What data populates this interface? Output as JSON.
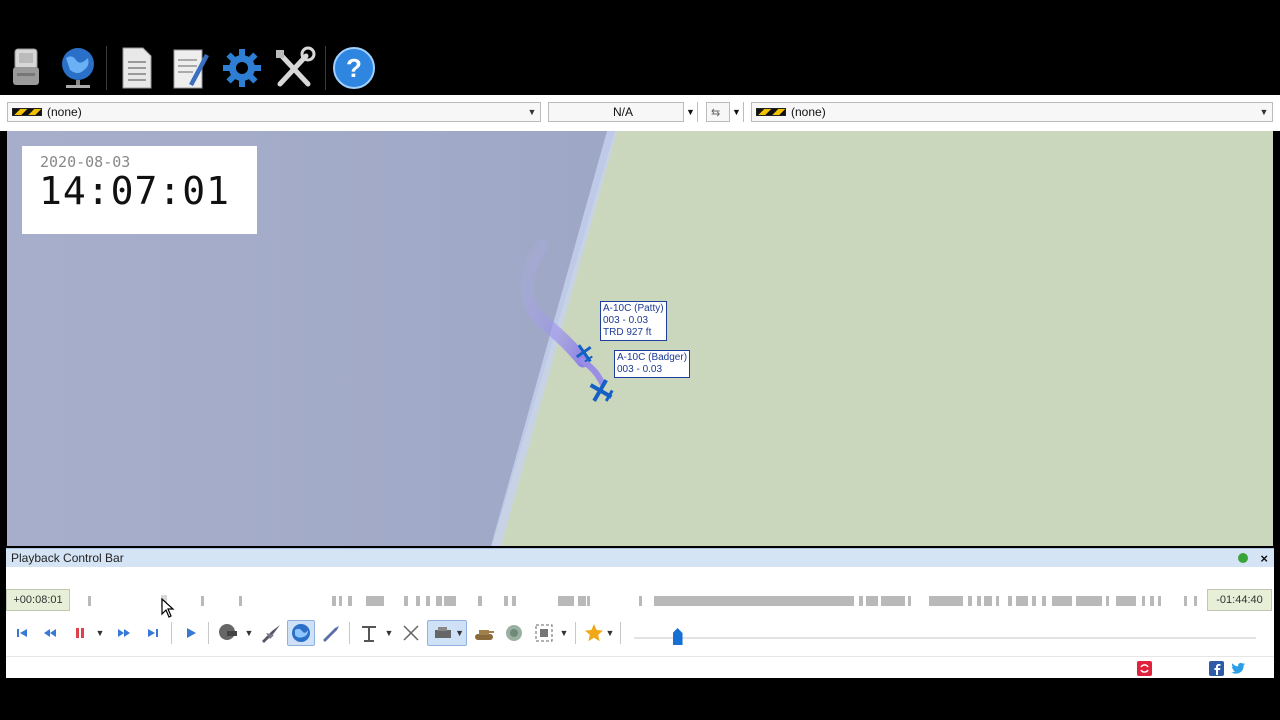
{
  "toolbar": {
    "buttons": [
      {
        "name": "usb-drive-icon"
      },
      {
        "name": "network-globe-icon"
      },
      {
        "name": "document-icon"
      },
      {
        "name": "notepad-icon"
      },
      {
        "name": "gear-icon"
      },
      {
        "name": "tools-icon"
      },
      {
        "name": "help-icon",
        "label": "?"
      }
    ]
  },
  "selectors": {
    "left_object": "(none)",
    "center_value": "N/A",
    "right_object": "(none)"
  },
  "map": {
    "date": "2020-08-03",
    "time": "14:07:01",
    "labels": [
      {
        "lines": [
          "A-10C (Patty)",
          "003 - 0.03",
          "TRD 927 ft"
        ]
      },
      {
        "lines": [
          "A-10C (Badger)",
          "003 - 0.03"
        ]
      }
    ]
  },
  "playback": {
    "title": "Playback Control Bar",
    "close_label": "×",
    "elapsed": "+00:08:01",
    "remaining": "-01:44:40",
    "speed_position": 0.07,
    "timeline_position": 0.071
  },
  "colors": {
    "sea": "#a4acc8",
    "land": "#cbd7bd",
    "accent": "#1670d4",
    "label_border": "#1f3f9a"
  }
}
